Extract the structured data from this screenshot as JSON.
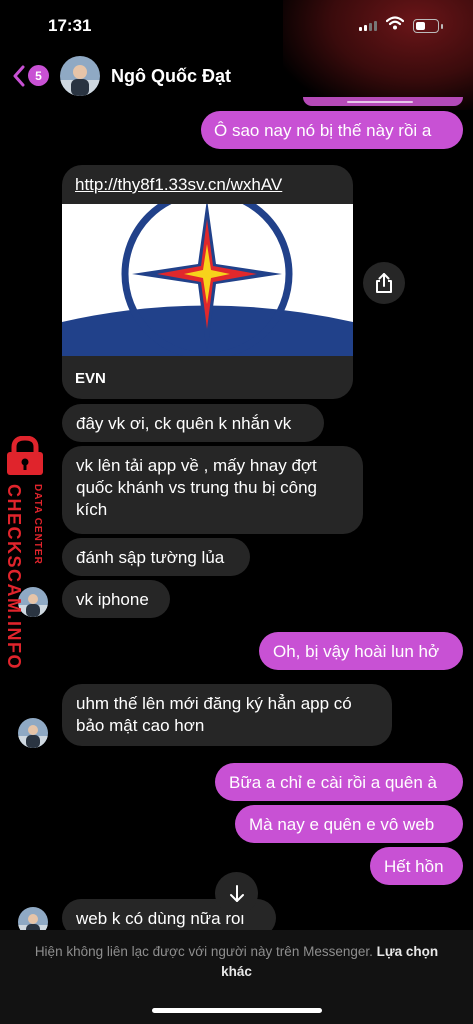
{
  "status_bar": {
    "time": "17:31",
    "battery_level": 0.45,
    "signal_bars": 2
  },
  "header": {
    "unread_count": "5",
    "contact_name": "Ngô Quốc Đạt"
  },
  "messages": {
    "m1": "Ô sao nay nó bị thế này rồi a",
    "link": {
      "url": "http://thy8f1.33sv.cn/wxhAV",
      "title": "EVN"
    },
    "m2": "đây vk ơi, ck quên k nhắn vk",
    "m3_l1": "vk lên tải app về , mấy hnay đợt",
    "m3_l2": "quốc khánh vs trung thu bị công",
    "m3_l3": "kích",
    "m4": "đánh sập tường lủa",
    "m5": "vk iphone",
    "m6": "Oh, bị vậy hoài lun hở",
    "m7_l1": "uhm thế lên mới đăng ký hẳn app có",
    "m7_l2": "bảo mật cao hơn",
    "m8": "Bữa a chỉ e cài rồi a quên à",
    "m9": "Mà nay e quên e vô web",
    "m10": "Hết hồn",
    "m11": "web k có dùng nữa rồi"
  },
  "watermark": {
    "main": "CHECKSCAM.INFO",
    "sub": "DATA CENTER"
  },
  "footer": {
    "notice": "Hiện không liên lạc được với người này trên Messenger.",
    "action": "Lựa chọn khác"
  },
  "colors": {
    "outgoing": "#c851d4",
    "incoming": "#262626",
    "background": "#000000",
    "watermark": "#e0242c"
  },
  "icons": [
    "back-chevron-icon",
    "share-icon",
    "arrow-down-icon",
    "lock-icon",
    "wifi-icon",
    "battery-icon",
    "signal-icon"
  ]
}
